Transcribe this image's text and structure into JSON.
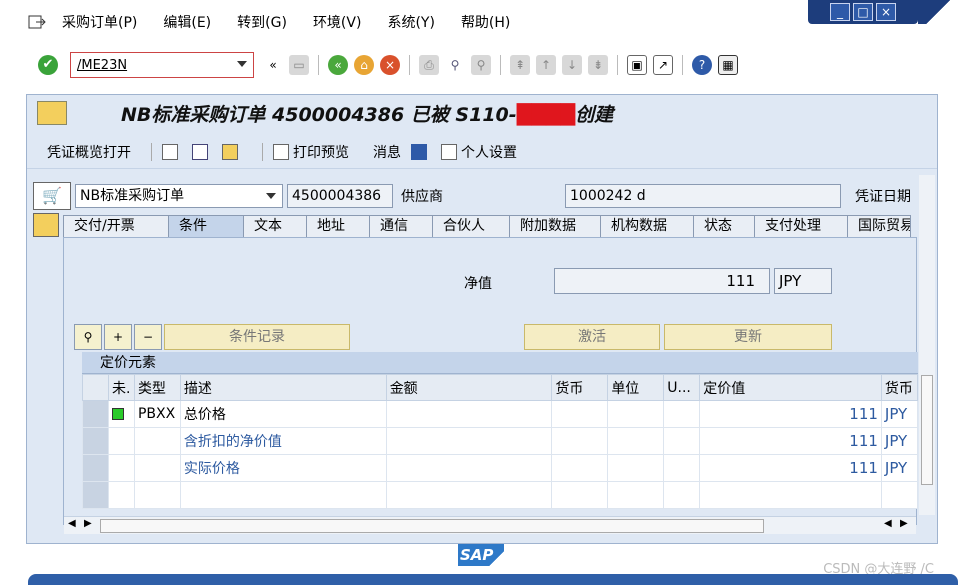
{
  "menu": [
    "采购订单(P)",
    "编辑(E)",
    "转到(G)",
    "环境(V)",
    "系统(Y)",
    "帮助(H)"
  ],
  "window_controls": [
    "_",
    "□",
    "×"
  ],
  "command_field": "/ME23N",
  "title": "NB标准采购订单 4500004386 已被 S110-",
  "title_suffix": "创建",
  "app_toolbar": {
    "overview": "凭证概览打开",
    "print_preview": "打印预览",
    "messages": "消息",
    "personal_settings": "个人设置"
  },
  "header": {
    "doc_type": "NB标准采购订单",
    "po_number": "4500004386",
    "vendor_label": "供应商",
    "vendor_value": "1000242 d",
    "doc_date_label": "凭证日期"
  },
  "tabs": [
    "交付/开票",
    "条件",
    "文本",
    "地址",
    "通信",
    "合伙人",
    "附加数据",
    "机构数据",
    "状态",
    "支付处理",
    "国际贸易"
  ],
  "net_value": {
    "label": "净值",
    "value": "111",
    "currency": "JPY"
  },
  "condition_buttons": {
    "records": "条件记录",
    "activate": "激活",
    "update": "更新"
  },
  "table_title": "定价元素",
  "table_columns": [
    "未.",
    "类型",
    "描述",
    "金额",
    "货币",
    "单位",
    "U...",
    "定价值",
    "货币"
  ],
  "table_rows": [
    {
      "status": true,
      "type": "PBXX",
      "desc": "总价格",
      "amount": "",
      "currency": "",
      "unit": "",
      "u": "",
      "cond_value": "111",
      "cond_currency": "JPY",
      "link": false
    },
    {
      "status": false,
      "type": "",
      "desc": "含折扣的净价值",
      "amount": "",
      "currency": "",
      "unit": "",
      "u": "",
      "cond_value": "111",
      "cond_currency": "JPY",
      "link": true
    },
    {
      "status": false,
      "type": "",
      "desc": "实际价格",
      "amount": "",
      "currency": "",
      "unit": "",
      "u": "",
      "cond_value": "111",
      "cond_currency": "JPY",
      "link": true
    },
    {
      "status": false,
      "type": "",
      "desc": "",
      "amount": "",
      "currency": "",
      "unit": "",
      "u": "",
      "cond_value": "",
      "cond_currency": "",
      "link": false
    }
  ],
  "sap_logo": "SAP",
  "watermark": "CSDN @大连野 /C"
}
